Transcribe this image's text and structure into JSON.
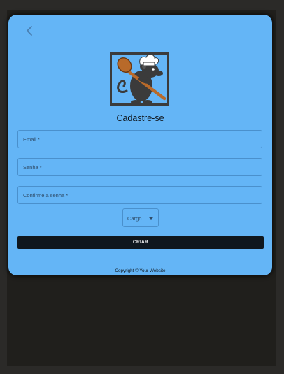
{
  "form": {
    "title": "Cadastre-se",
    "email_label": "Email *",
    "senha_label": "Senha *",
    "confirm_label": "Confirme a senha *",
    "cargo_select": "Cargo",
    "submit_label": "CRIAR"
  },
  "footer": {
    "copyright": "Copyright © Your Website"
  },
  "colors": {
    "card": "#64b5f6",
    "button": "#0f171e",
    "background": "#201f1c"
  },
  "icons": [
    "back-arrow-icon",
    "chef-rat-logo",
    "dropdown-caret-icon"
  ]
}
